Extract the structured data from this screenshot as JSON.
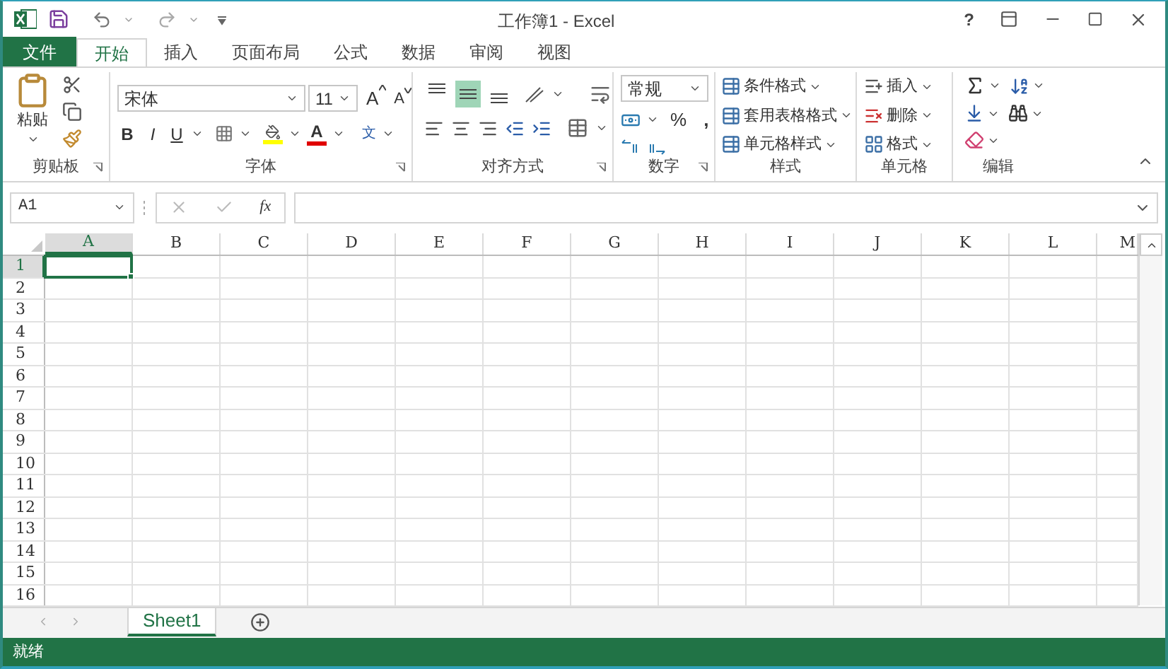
{
  "window": {
    "title": "工作簿1 - Excel",
    "help": "?"
  },
  "tabs": [
    {
      "label": "文件",
      "kind": "file",
      "selected": false
    },
    {
      "label": "开始",
      "kind": "tab",
      "selected": true
    },
    {
      "label": "插入",
      "kind": "tab",
      "selected": false
    },
    {
      "label": "页面布局",
      "kind": "tab",
      "selected": false
    },
    {
      "label": "公式",
      "kind": "tab",
      "selected": false
    },
    {
      "label": "数据",
      "kind": "tab",
      "selected": false
    },
    {
      "label": "审阅",
      "kind": "tab",
      "selected": false
    },
    {
      "label": "视图",
      "kind": "tab",
      "selected": false
    }
  ],
  "ribbon": {
    "clipboard": {
      "label": "剪贴板",
      "paste": "粘贴"
    },
    "font": {
      "label": "字体",
      "font_name": "宋体",
      "font_size": "11",
      "grow": "A",
      "shrink": "A",
      "bold": "B",
      "italic": "I",
      "underline": "U",
      "font_color": "A",
      "phonetic": "文"
    },
    "alignment": {
      "label": "对齐方式",
      "buttons": [
        {
          "kind": "top",
          "selected": false
        },
        {
          "kind": "middle",
          "selected": true
        },
        {
          "kind": "bottom",
          "selected": false
        }
      ]
    },
    "number": {
      "label": "数字",
      "format": "常规",
      "percent": "%",
      "comma": ","
    },
    "styles": {
      "label": "样式",
      "items": [
        "条件格式",
        "套用表格格式",
        "单元格样式"
      ]
    },
    "cells": {
      "label": "单元格",
      "items": [
        "插入",
        "删除",
        "格式"
      ]
    },
    "editing": {
      "label": "编辑"
    }
  },
  "formula_bar": {
    "name_box": "A1",
    "fx": "fx"
  },
  "grid": {
    "columns": [
      {
        "label": "A",
        "selected": true
      },
      {
        "label": "B",
        "selected": false
      },
      {
        "label": "C",
        "selected": false
      },
      {
        "label": "D",
        "selected": false
      },
      {
        "label": "E",
        "selected": false
      },
      {
        "label": "F",
        "selected": false
      },
      {
        "label": "G",
        "selected": false
      },
      {
        "label": "H",
        "selected": false
      },
      {
        "label": "I",
        "selected": false
      },
      {
        "label": "J",
        "selected": false
      },
      {
        "label": "K",
        "selected": false
      },
      {
        "label": "L",
        "selected": false
      },
      {
        "label": "M",
        "selected": false
      }
    ],
    "rows": [
      {
        "label": "1",
        "selected": true
      },
      {
        "label": "2",
        "selected": false
      },
      {
        "label": "3",
        "selected": false
      },
      {
        "label": "4",
        "selected": false
      },
      {
        "label": "5",
        "selected": false
      },
      {
        "label": "6",
        "selected": false
      },
      {
        "label": "7",
        "selected": false
      },
      {
        "label": "8",
        "selected": false
      },
      {
        "label": "9",
        "selected": false
      },
      {
        "label": "10",
        "selected": false
      },
      {
        "label": "11",
        "selected": false
      },
      {
        "label": "12",
        "selected": false
      },
      {
        "label": "13",
        "selected": false
      },
      {
        "label": "14",
        "selected": false
      },
      {
        "label": "15",
        "selected": false
      },
      {
        "label": "16",
        "selected": false
      }
    ]
  },
  "sheets": [
    {
      "label": "Sheet1",
      "selected": true
    }
  ],
  "status_bar": {
    "text": "就绪"
  }
}
